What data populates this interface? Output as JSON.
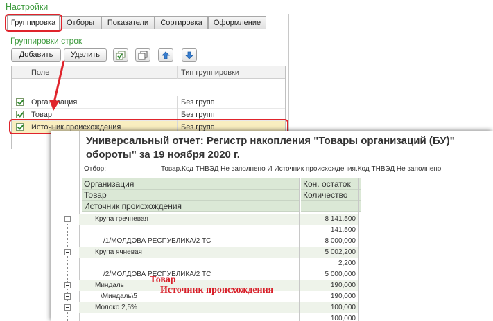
{
  "settings": {
    "title": "Настройки",
    "tabs": [
      "Группировка",
      "Отборы",
      "Показатели",
      "Сортировка",
      "Оформление"
    ],
    "active_tab": "Группировка"
  },
  "grouping": {
    "title": "Группировки строк",
    "add_label": "Добавить",
    "delete_label": "Удалить",
    "columns": [
      "Поле",
      "Тип группировки"
    ],
    "rows": [
      {
        "field": "Организация",
        "type": "Без групп",
        "checked": true
      },
      {
        "field": "Товар",
        "type": "Без групп",
        "checked": true
      },
      {
        "field": "Источник происхождения",
        "type": "Без групп",
        "checked": true
      }
    ]
  },
  "report": {
    "title_line1": "Универсальный отчет: Регистр накопления \"Товары организаций (БУ)\"",
    "title_line2": "обороты\" за 19 ноября 2020 г.",
    "filter_label": "Отбор:",
    "filter_value": "Товар.Код ТНВЭД Не заполнено И Источник происхождения.Код ТНВЭД Не заполнено",
    "header_left": [
      "Организация",
      "Товар",
      "Источник происхождения"
    ],
    "header_right": [
      "Кон. остаток",
      "Количество"
    ],
    "rows": [
      {
        "text": "Крупа гречневая",
        "value": "8 141,500"
      },
      {
        "text": "",
        "value": "141,500"
      },
      {
        "text": "/1/МОЛДОВА РЕСПУБЛИКА/2 ТС",
        "value": "8 000,000"
      },
      {
        "text": "Крупа ячневая",
        "value": "5 002,200"
      },
      {
        "text": "",
        "value": "2,200"
      },
      {
        "text": "/2/МОЛДОВА РЕСПУБЛИКА/2 ТС",
        "value": "5 000,000"
      },
      {
        "text": "Миндаль",
        "value": "190,000"
      },
      {
        "text": "\\Миндаль\\5",
        "value": "190,000"
      },
      {
        "text": "Молоко 2,5%",
        "value": "100,000"
      },
      {
        "text": "",
        "value": "100,000"
      }
    ]
  },
  "annotations": {
    "product": "Товар",
    "source": "Источник происхождения"
  },
  "colors": {
    "accent_green": "#3c9a3c",
    "highlight_red": "#e0242c",
    "selected_row": "#f9eec0",
    "report_header": "#dbe8d6"
  }
}
